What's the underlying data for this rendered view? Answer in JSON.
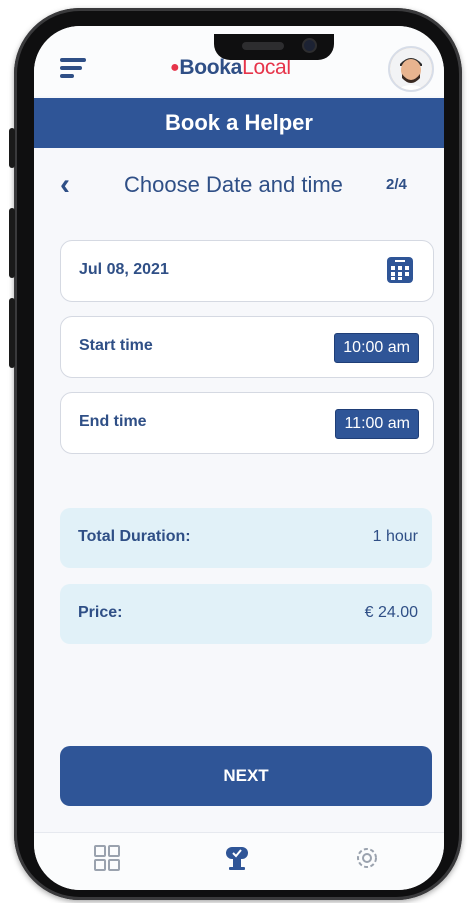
{
  "app": {
    "logo_part1": "Booka",
    "logo_part2": "Local",
    "title": "Book a Helper"
  },
  "step": {
    "title": "Choose Date and time",
    "count": "2/4"
  },
  "form": {
    "date": "Jul 08, 2021",
    "start_label": "Start time",
    "start_value": "10:00 am",
    "end_label": "End time",
    "end_value": "11:00 am"
  },
  "summary": {
    "duration_label": "Total Duration:",
    "duration_value": "1 hour",
    "price_label": "Price:",
    "price_value": "€ 24.00"
  },
  "actions": {
    "next_label": "NEXT"
  },
  "nav": {
    "items": [
      "grid-icon",
      "helper-icon",
      "settings-icon"
    ],
    "active_index": 1
  },
  "colors": {
    "brand_blue": "#2f5597",
    "text_blue": "#2f4f86",
    "accent_red": "#e6344a",
    "info_bg": "#e1f1f8"
  }
}
